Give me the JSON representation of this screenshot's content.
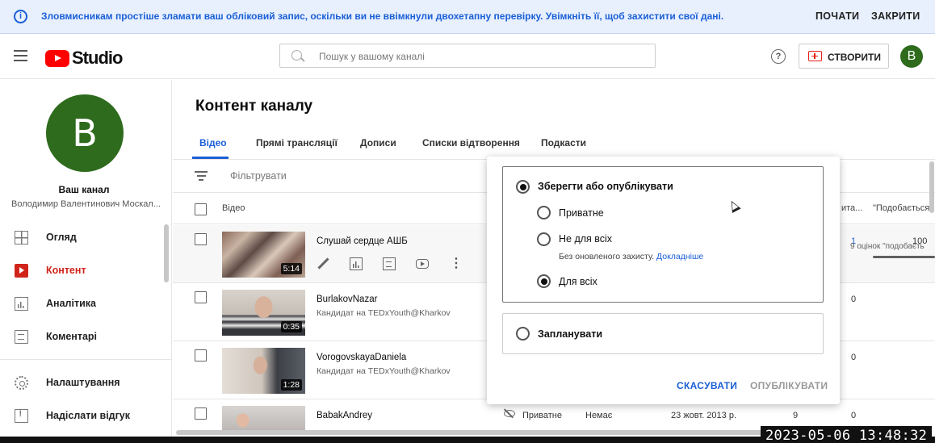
{
  "banner": {
    "message": "Зловмисникам простіше зламати ваш обліковий запис, оскільки ви не ввімкнули двохетапну перевірку. Увімкніть її, щоб захистити свої дані.",
    "start_label": "ПОЧАТИ",
    "close_label": "ЗАКРИТИ"
  },
  "header": {
    "logo_text": "Studio",
    "search_placeholder": "Пошук у вашому каналі",
    "create_label": "СТВОРИТИ",
    "avatar_letter": "B"
  },
  "sidebar": {
    "avatar_letter": "B",
    "channel_title": "Ваш канал",
    "channel_name": "Володимир Валентинович Москал...",
    "items": [
      {
        "label": "Огляд",
        "icon": "dashboard-icon"
      },
      {
        "label": "Контент",
        "icon": "content-icon"
      },
      {
        "label": "Аналітика",
        "icon": "analytics-icon"
      },
      {
        "label": "Коментарі",
        "icon": "comments-icon"
      },
      {
        "label": "Налаштування",
        "icon": "settings-icon"
      },
      {
        "label": "Надіслати відгук",
        "icon": "feedback-icon"
      }
    ]
  },
  "main": {
    "title": "Контент каналу",
    "tabs": [
      "Відео",
      "Прямі трансляції",
      "Дописи",
      "Списки відтворення",
      "Подкасти"
    ],
    "filter_label": "Фільтрувати",
    "columns": {
      "video": "Відео",
      "partial": "ита...",
      "likes": "\"Подобається\""
    },
    "rows": [
      {
        "title": "Слушай сердце АШБ",
        "subtitle": "",
        "duration": "5:14",
        "count": "1",
        "likes": "100",
        "likes_sub": "9 оцінок \"подобаєть"
      },
      {
        "title": "BurlakovNazar",
        "subtitle": "Кандидат на TEDxYouth@Kharkov",
        "duration": "0:35",
        "count": "0"
      },
      {
        "title": "VorogovskayaDaniela",
        "subtitle": "Кандидат на TEDxYouth@Kharkov",
        "duration": "1:28",
        "count": "0"
      },
      {
        "title": "BabakAndrey",
        "subtitle": "",
        "duration": "",
        "visibility": "Приватне",
        "restrictions": "Немає",
        "date": "23 жовт. 2013 р.",
        "views": "9",
        "count": "0"
      }
    ]
  },
  "popup": {
    "save_publish_label": "Зберегти або опублікувати",
    "private_label": "Приватне",
    "unlisted_label": "Не для всіх",
    "unlisted_hint": "Без оновленого захисту.",
    "learn_more": "Докладніше",
    "public_label": "Для всіх",
    "schedule_label": "Запланувати",
    "cancel_label": "СКАСУВАТИ",
    "publish_label": "ОПУБЛІКУВАТИ",
    "selected": "Для всіх"
  },
  "overlay": {
    "timestamp": "2023-05-06  13:48:32"
  },
  "colors": {
    "accent_blue": "#1a5fd6",
    "brand_red": "#ff0000",
    "active_red": "#d0241b",
    "avatar_green": "#2e6b1d"
  }
}
